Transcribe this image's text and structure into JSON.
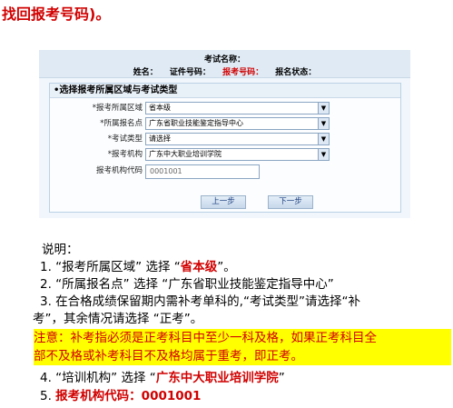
{
  "heading": "找回报考号码)。",
  "portal": {
    "exam_name_label": "考试名称：",
    "info_labels": [
      "姓名：",
      "证件号码：",
      "报考号码：",
      "报名状态："
    ]
  },
  "form": {
    "title": "•选择报考所属区域与考试类型",
    "rows": [
      {
        "label": "*报考所属区域",
        "value": "省本级"
      },
      {
        "label": "*所属报名点",
        "value": "广东省职业技能鉴定指导中心"
      },
      {
        "label": "*考试类型",
        "value": "请选择"
      },
      {
        "label": "*报考机构",
        "value": "广东中大职业培训学院"
      }
    ],
    "code_label": "报考机构代码",
    "code_value": "0001001",
    "prev_button": "上一步",
    "next_button": "下一步"
  },
  "notes": {
    "title": "说明：",
    "item1_prefix": "1. “报考所属区域” 选择  “",
    "item1_value": "省本级",
    "item1_suffix": "”。",
    "item2": "2. “所属报名点” 选择 “广东省职业技能鉴定指导中心”",
    "item3_line1": "3. 在合格成绩保留期内需补考单科的,“考试类型”请选择“补",
    "item3_line2": "考”，其余情况请选择 “正考”。",
    "warning_line1": "注意：补考指必须是正考科目中至少一科及格，如果正考科目全",
    "warning_line2": "部不及格或补考科目不及格均属于重考，即正考。",
    "item4_prefix": "4. “培训机构” 选择 “",
    "item4_value": "广东中大职业培训学院",
    "item4_suffix": "”",
    "item5_prefix": "5. ",
    "item5_value": "报考机构代码：0001001"
  }
}
